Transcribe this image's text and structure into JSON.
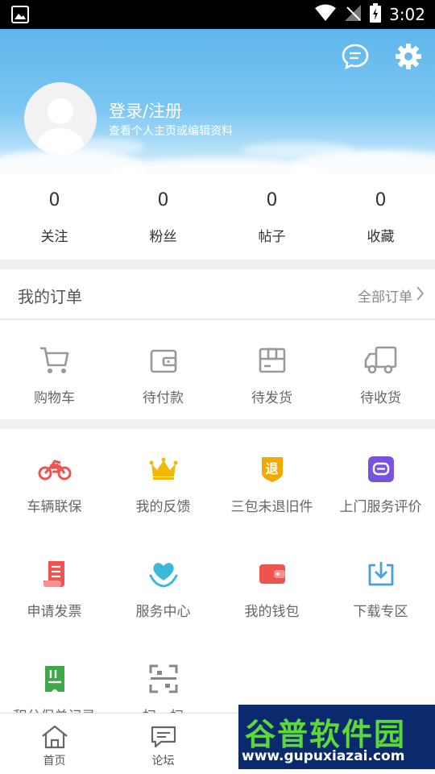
{
  "status_bar": {
    "time": "3:02"
  },
  "header": {
    "login_title": "登录/注册",
    "login_subtitle": "查看个人主页或编辑资料"
  },
  "stats": [
    {
      "value": "0",
      "label": "关注"
    },
    {
      "value": "0",
      "label": "粉丝"
    },
    {
      "value": "0",
      "label": "帖子"
    },
    {
      "value": "0",
      "label": "收藏"
    }
  ],
  "orders": {
    "title": "我的订单",
    "all_label": "全部订单",
    "items": [
      {
        "label": "购物车",
        "icon": "cart-icon"
      },
      {
        "label": "待付款",
        "icon": "wallet-icon"
      },
      {
        "label": "待发货",
        "icon": "package-icon"
      },
      {
        "label": "待收货",
        "icon": "truck-icon"
      }
    ]
  },
  "services": {
    "items": [
      {
        "label": "车辆联保",
        "icon": "motorcycle-icon"
      },
      {
        "label": "我的反馈",
        "icon": "crown-icon"
      },
      {
        "label": "三包未退旧件",
        "icon": "return-badge-icon",
        "badge": "退"
      },
      {
        "label": "上门服务评价",
        "icon": "chat-bubble-icon"
      },
      {
        "label": "申请发票",
        "icon": "invoice-icon"
      },
      {
        "label": "服务中心",
        "icon": "heart-hand-icon"
      },
      {
        "label": "我的钱包",
        "icon": "red-wallet-icon"
      },
      {
        "label": "下载专区",
        "icon": "download-icon"
      },
      {
        "label": "积分保单记录",
        "icon": "ticket-icon"
      },
      {
        "label": "扫一扫",
        "icon": "scan-icon"
      }
    ]
  },
  "bottom_nav": [
    {
      "label": "首页",
      "icon": "home-icon"
    },
    {
      "label": "论坛",
      "icon": "forum-icon"
    }
  ],
  "watermark": {
    "brand": "谷普软件园",
    "url": "www.gupuxiazai.com"
  },
  "colors": {
    "header_sky": "#6cbcf0",
    "icon_gray": "#999999",
    "red": "#f0524f",
    "gold": "#f5b800",
    "purple": "#7a52e0",
    "teal": "#3cb8d8",
    "blue": "#4a9fe0",
    "green": "#3fa84b",
    "watermark_bg": "#0b2a6e",
    "watermark_green": "#5cd83a"
  }
}
